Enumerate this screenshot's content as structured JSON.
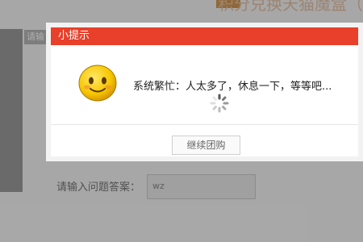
{
  "background": {
    "title_fragment": "积分兑换天猫魔盒（无",
    "left_label": "请输",
    "question_label": "请输入问题答案：",
    "answer_value": "wz"
  },
  "dialog": {
    "title": "小提示",
    "message": "系统繁忙：人太多了，休息一下，等等吧...",
    "continue_label": "继续团购",
    "icon": "smiley-icon",
    "loading_icon": "spinner-icon"
  },
  "colors": {
    "header_red": "#e8402a",
    "smiley_yellow": "#f7c600"
  }
}
